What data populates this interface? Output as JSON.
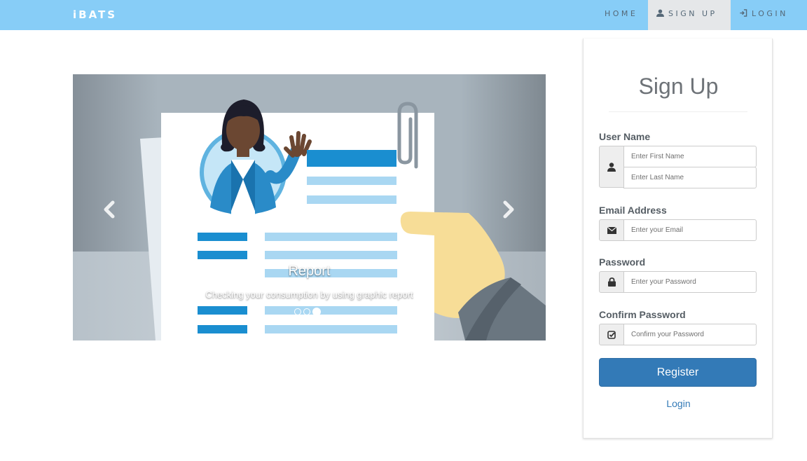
{
  "navbar": {
    "brand": "iBATS",
    "home": "HOME",
    "signup": "SIGN UP",
    "login": "LOGIN",
    "icons": {
      "signup": "user-icon",
      "login": "sign-in-icon"
    }
  },
  "carousel": {
    "caption_title": "Report",
    "caption_text": "Checking your consumption by using graphic report",
    "slide_count": 3,
    "active_slide": 3,
    "icons": {
      "prev": "chevron-left-icon",
      "next": "chevron-right-icon"
    }
  },
  "signup": {
    "title": "Sign Up",
    "username": {
      "label": "User Name",
      "first_placeholder": "Enter First Name",
      "last_placeholder": "Enter Last Name",
      "icon": "user-icon"
    },
    "email": {
      "label": "Email Address",
      "placeholder": "Enter your Email",
      "icon": "envelope-icon"
    },
    "password": {
      "label": "Password",
      "placeholder": "Enter your Password",
      "icon": "lock-icon"
    },
    "confirm": {
      "label": "Confirm Password",
      "placeholder": "Confirm your Password",
      "icon": "check-square-icon"
    },
    "register_label": "Register",
    "login_link": "Login"
  },
  "colors": {
    "navbar": "#87cdf7",
    "primary_button": "#337ab7",
    "active_nav": "#e5e7e9"
  }
}
